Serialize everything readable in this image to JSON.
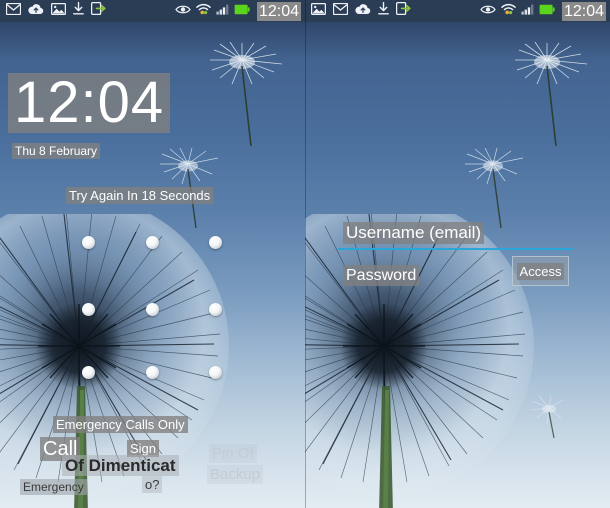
{
  "meta": {
    "accent_cyan": "#2aa7d8",
    "status_bar_bg": "#2b3c55",
    "highlight_bg": "#808080",
    "battery_green": "#5bd41e"
  },
  "left_panel": {
    "status_bar": {
      "left_icons": [
        "mail-icon",
        "cloud-upload-icon",
        "image-icon",
        "download-icon",
        "share-app-icon"
      ],
      "right_icons": [
        "eye-icon",
        "wifi-icon",
        "signal-bars-icon",
        "battery-icon"
      ],
      "time": "12:04"
    },
    "clock": "12:04",
    "date": "Thu 8 February",
    "retry_message": "Try Again In 18 Seconds",
    "pattern_lock": {
      "rows": 3,
      "columns": 3,
      "dot_count": 9
    },
    "labels": {
      "emergency_calls_only": "Emergency Calls Only",
      "call": "Call",
      "sign": "Sign",
      "of_dimenticat": "Of Dimenticat",
      "o_question": "o?",
      "emergency": "Emergency",
      "pin_of": "Pin Of",
      "backup": "Backup"
    }
  },
  "right_panel": {
    "status_bar": {
      "left_icons": [
        "image-icon",
        "mail-icon",
        "cloud-upload-icon",
        "download-icon",
        "share-app-icon"
      ],
      "right_icons": [
        "eye-icon",
        "wifi-icon",
        "signal-bars-icon",
        "battery-icon"
      ],
      "time": "12:04"
    },
    "username_field": {
      "label": "Username (email)",
      "value": ""
    },
    "password_field": {
      "label": "Password",
      "value": ""
    },
    "access_button": "Access"
  }
}
